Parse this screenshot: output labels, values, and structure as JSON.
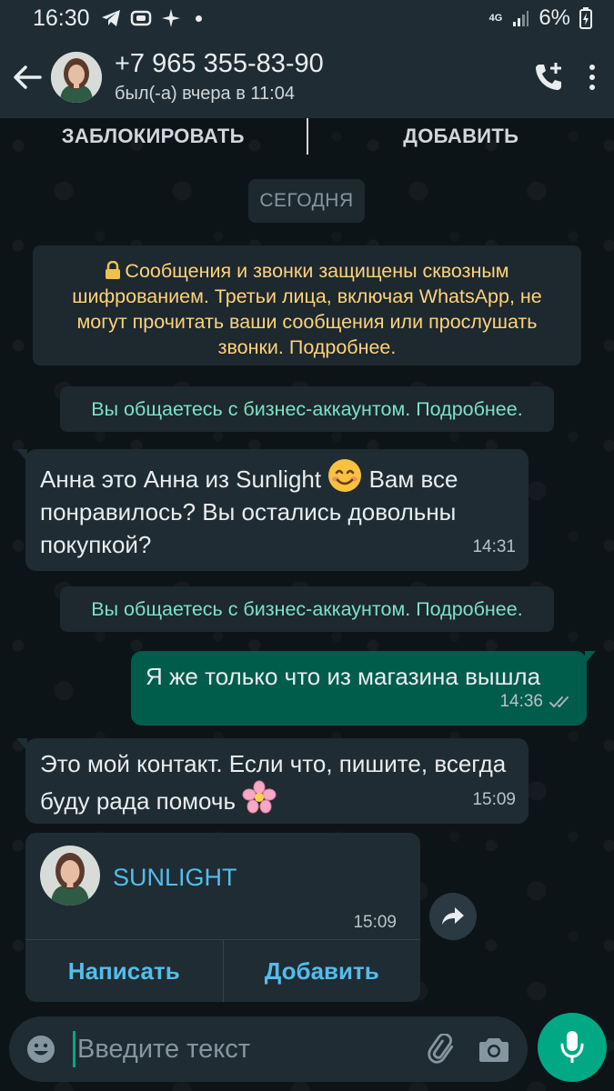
{
  "status_bar": {
    "time": "16:30",
    "network": "4G",
    "battery": "6%"
  },
  "header": {
    "contact_name": "+7 965 355-83-90",
    "last_seen": "был(-а) вчера в 11:04"
  },
  "action_bar": {
    "block_label": "ЗАБЛОКИРОВАТЬ",
    "add_label": "ДОБАВИТЬ"
  },
  "chat": {
    "date_label": "СЕГОДНЯ",
    "encryption_notice": "Сообщения и звонки защищены сквозным шифрованием. Третьи лица, включая WhatsApp, не могут прочитать ваши сообщения или прослушать звонки. Подробнее.",
    "business_notice": "Вы общаетесь с бизнес-аккаунтом. Подробнее.",
    "messages": [
      {
        "direction": "in",
        "text_before": "Анна это Анна из Sunlight",
        "text_after": "Вам все понравилось? Вы остались довольны покупкой?",
        "emoji": "smiling-face",
        "time": "14:31"
      },
      {
        "direction": "out",
        "text": "Я же только что из магазина вышла",
        "time": "14:36",
        "status": "read"
      },
      {
        "direction": "in",
        "text": "Это мой контакт. Если что, пишите, всегда буду рада помочь",
        "emoji": "cherry-blossom",
        "time": "15:09"
      }
    ],
    "contact_card": {
      "name": "SUNLIGHT",
      "time": "15:09",
      "message_button": "Написать",
      "add_button": "Добавить"
    }
  },
  "composer": {
    "placeholder": "Введите текст"
  },
  "colors": {
    "accent": "#00a884",
    "outgoing_bubble": "#005c4b",
    "incoming_bubble": "#1f2c33",
    "link": "#53bdeb",
    "encryption_text": "#ffd279",
    "business_text": "#7ae3c3"
  }
}
